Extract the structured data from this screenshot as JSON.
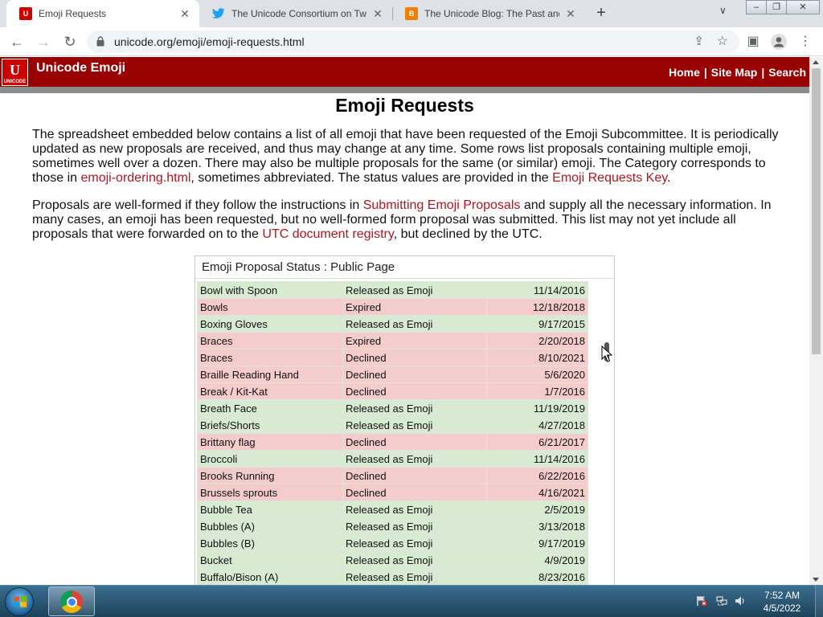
{
  "browser": {
    "tabs": [
      {
        "title": "Emoji Requests",
        "favicon": "unicode-favicon",
        "active": true
      },
      {
        "title": "The Unicode Consortium on Twit",
        "favicon": "twitter-favicon",
        "active": false
      },
      {
        "title": "The Unicode Blog: The Past and",
        "favicon": "blogger-favicon",
        "active": false
      }
    ],
    "url": "unicode.org/emoji/emoji-requests.html"
  },
  "site": {
    "logo_text": "U",
    "logo_sub": "UNICODE",
    "title": "Unicode Emoji",
    "links": [
      "Home",
      "Site Map",
      "Search"
    ]
  },
  "page": {
    "heading": "Emoji Requests",
    "p1": {
      "t1": "The spreadsheet embedded below contains a list of all emoji that have been requested of the Emoji Subcommittee. It is periodically updated as new proposals are received, and thus may change at any time. Some rows list proposals containing multiple emoji, sometimes well over a dozen. There may also be multiple proposals for the same (or similar) emoji. The Category corresponds to those in ",
      "link1": "emoji-ordering.html",
      "t2": ", sometimes abbreviated. The status values are provided in the ",
      "link2": "Emoji Requests Key",
      "t3": "."
    },
    "p2": {
      "t1": "Proposals are well-formed if they follow the instructions in ",
      "link1": "Submitting Emoji Proposals",
      "t2": " and supply all the necessary information. In many cases, an emoji has been requested, but no well-formed form proposal was submitted. This list may not yet include all proposals that were forwarded on to the ",
      "link2": "UTC document registry",
      "t3": ", but declined by the UTC."
    }
  },
  "sheet": {
    "title": "Emoji Proposal Status : Public Page",
    "rows": [
      {
        "name": "Bowl with Spoon",
        "status": "Released as Emoji",
        "date": "11/14/2016"
      },
      {
        "name": "Bowls",
        "status": "Expired",
        "date": "12/18/2018"
      },
      {
        "name": "Boxing Gloves",
        "status": "Released as Emoji",
        "date": "9/17/2015"
      },
      {
        "name": "Braces",
        "status": "Expired",
        "date": "2/20/2018"
      },
      {
        "name": "Braces",
        "status": "Declined",
        "date": "8/10/2021"
      },
      {
        "name": "Braille Reading Hand",
        "status": "Declined",
        "date": "5/6/2020"
      },
      {
        "name": "Break / Kit-Kat",
        "status": "Declined",
        "date": "1/7/2016"
      },
      {
        "name": "Breath Face",
        "status": "Released as Emoji",
        "date": "11/19/2019"
      },
      {
        "name": "Briefs/Shorts",
        "status": "Released as Emoji",
        "date": "4/27/2018"
      },
      {
        "name": "Brittany flag",
        "status": "Declined",
        "date": "6/21/2017"
      },
      {
        "name": "Broccoli",
        "status": "Released as Emoji",
        "date": "11/14/2016"
      },
      {
        "name": "Brooks Running",
        "status": "Declined",
        "date": "6/22/2016"
      },
      {
        "name": "Brussels sprouts",
        "status": "Declined",
        "date": "4/16/2021"
      },
      {
        "name": "Bubble Tea",
        "status": "Released as Emoji",
        "date": "2/5/2019"
      },
      {
        "name": "Bubbles (A)",
        "status": "Released as Emoji",
        "date": "3/13/2018"
      },
      {
        "name": "Bubbles (B)",
        "status": "Released as Emoji",
        "date": "9/17/2019"
      },
      {
        "name": "Bucket",
        "status": "Released as Emoji",
        "date": "4/9/2019"
      },
      {
        "name": "Buffalo/Bison (A)",
        "status": "Released as Emoji",
        "date": "8/23/2016"
      }
    ],
    "colors": {
      "released": "#d9ead3",
      "declined": "#f4cccc"
    }
  },
  "taskbar": {
    "time": "7:52 AM",
    "date": "4/5/2022"
  }
}
